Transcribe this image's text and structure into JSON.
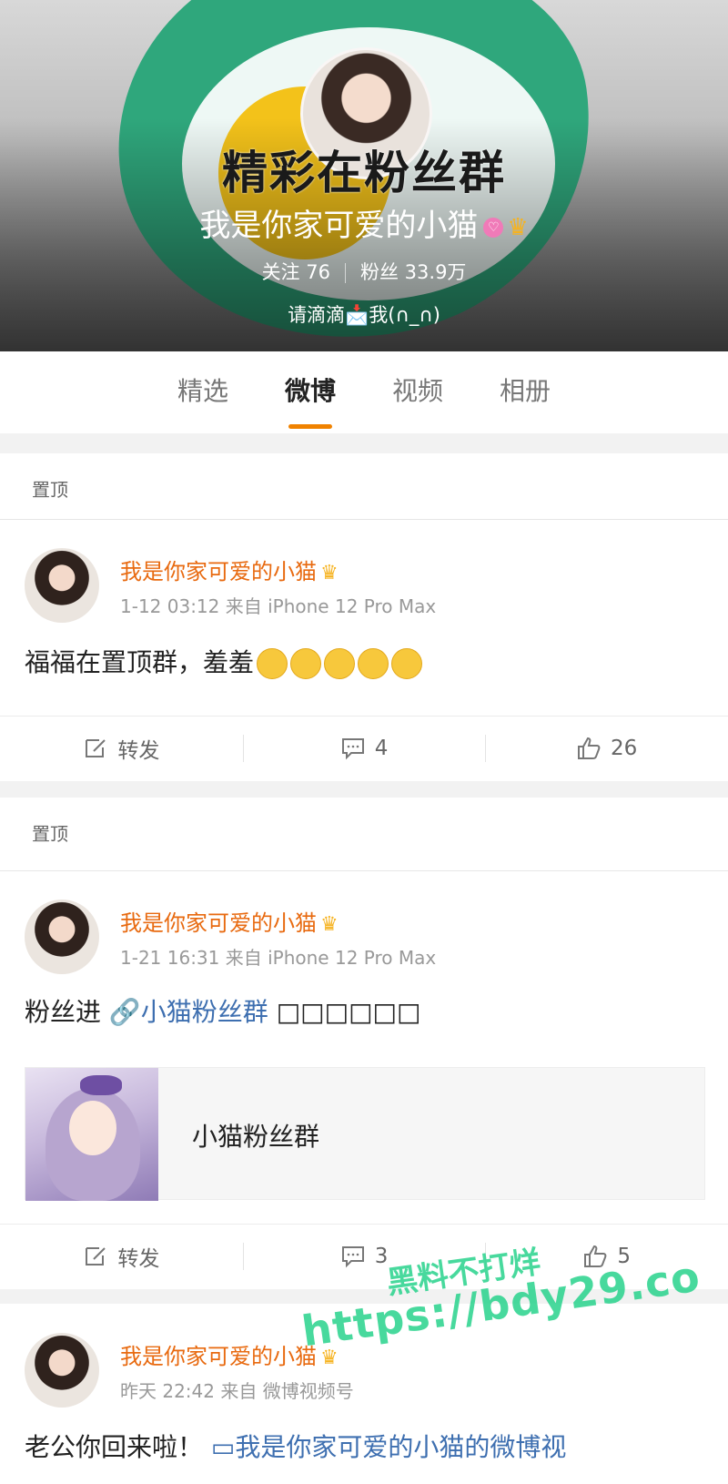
{
  "profile": {
    "banner_slogan": "精彩在粉丝群",
    "name": "我是你家可爱的小猫",
    "vip_icon": "vip-badge-icon",
    "crown_icon": "crown-icon",
    "following_label": "关注",
    "following_count": "76",
    "followers_label": "粉丝",
    "followers_count": "33.9万",
    "bio": "请滴滴📩我(∩_∩)"
  },
  "tabs": [
    {
      "label": "精选",
      "active": false
    },
    {
      "label": "微博",
      "active": true
    },
    {
      "label": "视频",
      "active": false
    },
    {
      "label": "相册",
      "active": false
    }
  ],
  "posts": [
    {
      "pinned_label": "置顶",
      "author": "我是你家可爱的小猫",
      "meta": "1-12 03:12 来自 iPhone 12 Pro Max",
      "text": "福福在置顶群，羞羞",
      "emoji_count": 5,
      "repost_label": "转发",
      "comment_count": "4",
      "like_count": "26"
    },
    {
      "pinned_label": "置顶",
      "author": "我是你家可爱的小猫",
      "meta": "1-21 16:31 来自 iPhone 12 Pro Max",
      "text_prefix": "粉丝进",
      "link_text": "小猫粉丝群",
      "text_suffix": "□□□□□□",
      "card_title": "小猫粉丝群",
      "repost_label": "转发",
      "comment_count": "3",
      "like_count": "5"
    },
    {
      "author": "我是你家可爱的小猫",
      "meta": "昨天 22:42 来自 微博视频号",
      "text_prefix": "老公你回来啦！",
      "link_text": "我是你家可爱的小猫的微博视"
    }
  ],
  "watermark": {
    "line1": "黑料不打烊",
    "line2": "https://bdy29.co"
  },
  "colors": {
    "accent_orange": "#f08200",
    "name_orange": "#e86a10",
    "link_blue": "#3e6fb0",
    "watermark_green": "#28d28c"
  }
}
